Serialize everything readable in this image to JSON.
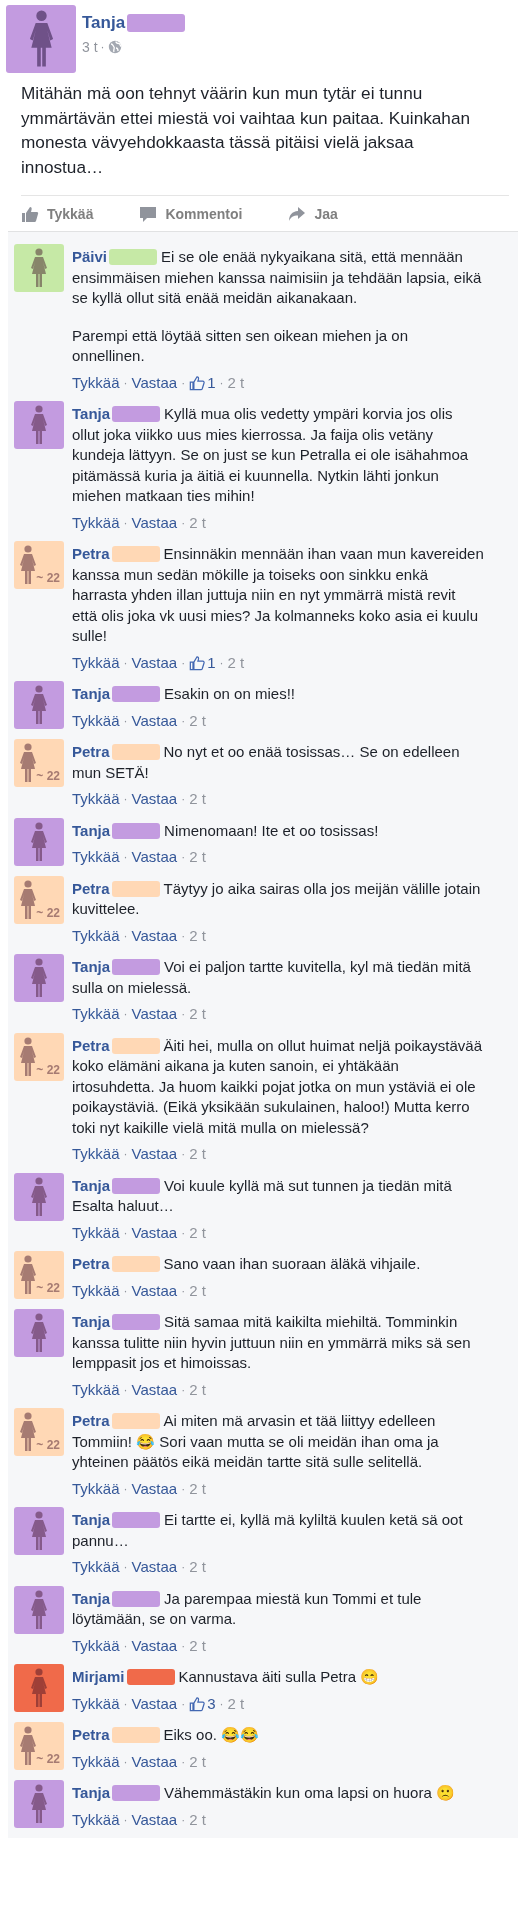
{
  "post": {
    "author": {
      "name": "Tanja",
      "color": "#c39be0"
    },
    "meta": [
      {
        "kind": "time",
        "text": "3 t"
      },
      {
        "kind": "sep",
        "text": "·"
      }
    ],
    "text": "Mitähän mä oon tehnyt väärin kun mun tytär ei tunnu ymmärtävän ettei miestä voi vaihtaa kun paitaa. Kuinkahan monesta vävyehdokkaasta tässä pitäisi vielä jaksaa innostua…",
    "actions": [
      {
        "kind": "like",
        "label": "Tykkää"
      },
      {
        "kind": "comment",
        "label": "Kommentoi"
      },
      {
        "kind": "share",
        "label": "Jaa"
      }
    ]
  },
  "comments": [
    {
      "author": "Päivi",
      "color": "#c6e9a6",
      "paragraphs": [
        "Ei se ole enää nykyaikana sitä, että mennään ensimmäisen miehen kanssa naimisiin ja tehdään lapsia, eikä se kyllä ollut sitä enää meidän aikanakaan.",
        "Parempi että löytää sitten sen oikean miehen ja on onnellinen."
      ],
      "meta": [
        {
          "kind": "link",
          "text": "Tykkää"
        },
        {
          "kind": "sep",
          "text": "·"
        },
        {
          "kind": "link",
          "text": "Vastaa"
        },
        {
          "kind": "sep",
          "text": "·"
        },
        {
          "kind": "likes",
          "text": "1"
        },
        {
          "kind": "sep",
          "text": "·"
        },
        {
          "kind": "time",
          "text": "2 t"
        }
      ]
    },
    {
      "author": "Tanja",
      "color": "#c39be0",
      "paragraphs": [
        "Kyllä mua olis vedetty ympäri korvia jos olis ollut joka viikko uus mies kierrossa. Ja faija olis vetäny kundeja lättyyn. Se on just se kun Petralla ei ole isähahmoa pitämässä kuria ja äitiä ei kuunnella. Nytkin lähti jonkun miehen matkaan ties mihin!"
      ],
      "meta": [
        {
          "kind": "link",
          "text": "Tykkää"
        },
        {
          "kind": "sep",
          "text": "·"
        },
        {
          "kind": "link",
          "text": "Vastaa"
        },
        {
          "kind": "sep",
          "text": "·"
        },
        {
          "kind": "time",
          "text": "2 t"
        }
      ]
    },
    {
      "author": "Petra",
      "color": "#ffd8b5",
      "badge": "~ 22",
      "paragraphs": [
        "Ensinnäkin mennään ihan vaan mun kavereiden kanssa mun sedän mökille ja toiseks oon sinkku enkä harrasta yhden illan juttuja niin en nyt ymmärrä mistä revit että olis joka vk uusi mies? Ja kolmanneks koko asia ei kuulu sulle!"
      ],
      "meta": [
        {
          "kind": "link",
          "text": "Tykkää"
        },
        {
          "kind": "sep",
          "text": "·"
        },
        {
          "kind": "link",
          "text": "Vastaa"
        },
        {
          "kind": "sep",
          "text": "·"
        },
        {
          "kind": "likes",
          "text": "1"
        },
        {
          "kind": "sep",
          "text": "·"
        },
        {
          "kind": "time",
          "text": "2 t"
        }
      ]
    },
    {
      "author": "Tanja",
      "color": "#c39be0",
      "paragraphs": [
        "Esakin on on mies!!"
      ],
      "meta": [
        {
          "kind": "link",
          "text": "Tykkää"
        },
        {
          "kind": "sep",
          "text": "·"
        },
        {
          "kind": "link",
          "text": "Vastaa"
        },
        {
          "kind": "sep",
          "text": "·"
        },
        {
          "kind": "time",
          "text": "2 t"
        }
      ]
    },
    {
      "author": "Petra",
      "color": "#ffd8b5",
      "badge": "~ 22",
      "paragraphs": [
        "No nyt et oo enää tosissas… Se on edelleen mun SETÄ!"
      ],
      "meta": [
        {
          "kind": "link",
          "text": "Tykkää"
        },
        {
          "kind": "sep",
          "text": "·"
        },
        {
          "kind": "link",
          "text": "Vastaa"
        },
        {
          "kind": "sep",
          "text": "·"
        },
        {
          "kind": "time",
          "text": "2 t"
        }
      ]
    },
    {
      "author": "Tanja",
      "color": "#c39be0",
      "paragraphs": [
        "Nimenomaan! Ite et oo tosissas!"
      ],
      "meta": [
        {
          "kind": "link",
          "text": "Tykkää"
        },
        {
          "kind": "sep",
          "text": "·"
        },
        {
          "kind": "link",
          "text": "Vastaa"
        },
        {
          "kind": "sep",
          "text": "·"
        },
        {
          "kind": "time",
          "text": "2 t"
        }
      ]
    },
    {
      "author": "Petra",
      "color": "#ffd8b5",
      "badge": "~ 22",
      "paragraphs": [
        "Täytyy jo aika sairas olla jos meijän välille jotain kuvittelee."
      ],
      "meta": [
        {
          "kind": "link",
          "text": "Tykkää"
        },
        {
          "kind": "sep",
          "text": "·"
        },
        {
          "kind": "link",
          "text": "Vastaa"
        },
        {
          "kind": "sep",
          "text": "·"
        },
        {
          "kind": "time",
          "text": "2 t"
        }
      ]
    },
    {
      "author": "Tanja",
      "color": "#c39be0",
      "paragraphs": [
        "Voi ei paljon tartte kuvitella, kyl mä tiedän mitä sulla on mielessä."
      ],
      "meta": [
        {
          "kind": "link",
          "text": "Tykkää"
        },
        {
          "kind": "sep",
          "text": "·"
        },
        {
          "kind": "link",
          "text": "Vastaa"
        },
        {
          "kind": "sep",
          "text": "·"
        },
        {
          "kind": "time",
          "text": "2 t"
        }
      ]
    },
    {
      "author": "Petra",
      "color": "#ffd8b5",
      "badge": "~ 22",
      "paragraphs": [
        "Äiti hei, mulla on ollut huimat neljä poikaystävää koko elämäni aikana ja kuten sanoin, ei yhtäkään irtosuhdetta. Ja huom kaikki pojat jotka on mun ystäviä ei ole poikaystäviä. (Eikä yksikään sukulainen, haloo!) Mutta kerro toki nyt kaikille vielä mitä mulla on mielessä?"
      ],
      "meta": [
        {
          "kind": "link",
          "text": "Tykkää"
        },
        {
          "kind": "sep",
          "text": "·"
        },
        {
          "kind": "link",
          "text": "Vastaa"
        },
        {
          "kind": "sep",
          "text": "·"
        },
        {
          "kind": "time",
          "text": "2 t"
        }
      ]
    },
    {
      "author": "Tanja",
      "color": "#c39be0",
      "paragraphs": [
        "Voi kuule kyllä mä sut tunnen ja tiedän mitä Esalta haluut…"
      ],
      "meta": [
        {
          "kind": "link",
          "text": "Tykkää"
        },
        {
          "kind": "sep",
          "text": "·"
        },
        {
          "kind": "link",
          "text": "Vastaa"
        },
        {
          "kind": "sep",
          "text": "·"
        },
        {
          "kind": "time",
          "text": "2 t"
        }
      ]
    },
    {
      "author": "Petra",
      "color": "#ffd8b5",
      "badge": "~ 22",
      "paragraphs": [
        "Sano vaan ihan suoraan äläkä vihjaile."
      ],
      "meta": [
        {
          "kind": "link",
          "text": "Tykkää"
        },
        {
          "kind": "sep",
          "text": "·"
        },
        {
          "kind": "link",
          "text": "Vastaa"
        },
        {
          "kind": "sep",
          "text": "·"
        },
        {
          "kind": "time",
          "text": "2 t"
        }
      ]
    },
    {
      "author": "Tanja",
      "color": "#c39be0",
      "paragraphs": [
        "Sitä samaa mitä kaikilta miehiltä. Tomminkin kanssa tulitte niin hyvin juttuun niin en ymmärrä miks sä sen lemppasit jos et himoissas."
      ],
      "meta": [
        {
          "kind": "link",
          "text": "Tykkää"
        },
        {
          "kind": "sep",
          "text": "·"
        },
        {
          "kind": "link",
          "text": "Vastaa"
        },
        {
          "kind": "sep",
          "text": "·"
        },
        {
          "kind": "time",
          "text": "2 t"
        }
      ]
    },
    {
      "author": "Petra",
      "color": "#ffd8b5",
      "badge": "~ 22",
      "paragraphs": [
        "Ai miten mä arvasin et tää liittyy edelleen Tommiin! 😂 Sori vaan mutta se oli meidän ihan oma ja yhteinen päätös eikä meidän tartte sitä sulle selitellä."
      ],
      "meta": [
        {
          "kind": "link",
          "text": "Tykkää"
        },
        {
          "kind": "sep",
          "text": "·"
        },
        {
          "kind": "link",
          "text": "Vastaa"
        },
        {
          "kind": "sep",
          "text": "·"
        },
        {
          "kind": "time",
          "text": "2 t"
        }
      ]
    },
    {
      "author": "Tanja",
      "color": "#c39be0",
      "paragraphs": [
        "Ei tartte ei, kyllä mä kyliltä kuulen ketä sä oot pannu…"
      ],
      "meta": [
        {
          "kind": "link",
          "text": "Tykkää"
        },
        {
          "kind": "sep",
          "text": "·"
        },
        {
          "kind": "link",
          "text": "Vastaa"
        },
        {
          "kind": "sep",
          "text": "·"
        },
        {
          "kind": "time",
          "text": "2 t"
        }
      ]
    },
    {
      "author": "Tanja",
      "color": "#c39be0",
      "paragraphs": [
        "Ja parempaa miestä kun Tommi et tule löytämään, se on varma."
      ],
      "meta": [
        {
          "kind": "link",
          "text": "Tykkää"
        },
        {
          "kind": "sep",
          "text": "·"
        },
        {
          "kind": "link",
          "text": "Vastaa"
        },
        {
          "kind": "sep",
          "text": "·"
        },
        {
          "kind": "time",
          "text": "2 t"
        }
      ]
    },
    {
      "author": "Mirjami",
      "color": "#f06a4a",
      "paragraphs": [
        "Kannustava äiti sulla Petra 😁"
      ],
      "meta": [
        {
          "kind": "link",
          "text": "Tykkää"
        },
        {
          "kind": "sep",
          "text": "·"
        },
        {
          "kind": "link",
          "text": "Vastaa"
        },
        {
          "kind": "sep",
          "text": "·"
        },
        {
          "kind": "likes",
          "text": "3"
        },
        {
          "kind": "sep",
          "text": "·"
        },
        {
          "kind": "time",
          "text": "2 t"
        }
      ]
    },
    {
      "author": "Petra",
      "color": "#ffd8b5",
      "badge": "~ 22",
      "paragraphs": [
        "Eiks oo. 😂😂"
      ],
      "meta": [
        {
          "kind": "link",
          "text": "Tykkää"
        },
        {
          "kind": "sep",
          "text": "·"
        },
        {
          "kind": "link",
          "text": "Vastaa"
        },
        {
          "kind": "sep",
          "text": "·"
        },
        {
          "kind": "time",
          "text": "2 t"
        }
      ]
    },
    {
      "author": "Tanja",
      "color": "#c39be0",
      "paragraphs": [
        "Vähemmästäkin kun oma lapsi on huora 🙁"
      ],
      "meta": [
        {
          "kind": "link",
          "text": "Tykkää"
        },
        {
          "kind": "sep",
          "text": "·"
        },
        {
          "kind": "link",
          "text": "Vastaa"
        },
        {
          "kind": "sep",
          "text": "·"
        },
        {
          "kind": "time",
          "text": "2 t"
        }
      ]
    }
  ]
}
